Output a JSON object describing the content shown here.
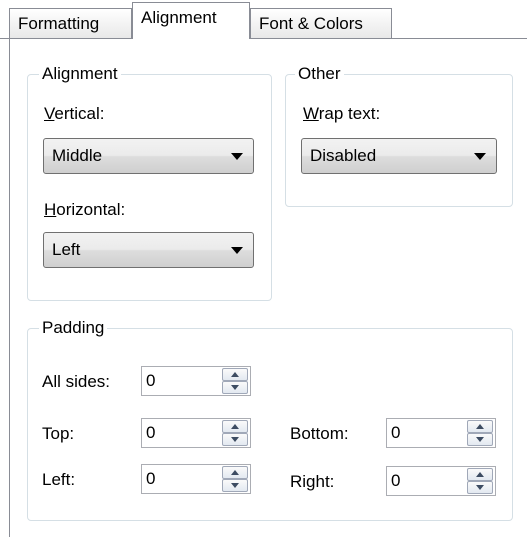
{
  "tabs": [
    {
      "label": "Formatting",
      "active": false
    },
    {
      "label": "Alignment",
      "active": true
    },
    {
      "label": "Font & Colors",
      "active": false
    }
  ],
  "alignment_group": {
    "title": "Alignment",
    "vertical": {
      "label_mnemonic": "V",
      "label_rest": "ertical:",
      "value": "Middle"
    },
    "horizontal": {
      "label_mnemonic": "H",
      "label_rest": "orizontal:",
      "value": "Left"
    }
  },
  "other_group": {
    "title": "Other",
    "wrap": {
      "label_mnemonic": "W",
      "label_rest": "rap text:",
      "value": "Disabled"
    }
  },
  "padding_group": {
    "title": "Padding",
    "all_sides": {
      "label": "All sides:",
      "value": "0"
    },
    "top": {
      "label": "Top:",
      "value": "0"
    },
    "bottom": {
      "label": "Bottom:",
      "value": "0"
    },
    "left": {
      "label": "Left:",
      "value": "0"
    },
    "right": {
      "label": "Right:",
      "value": "0"
    }
  }
}
